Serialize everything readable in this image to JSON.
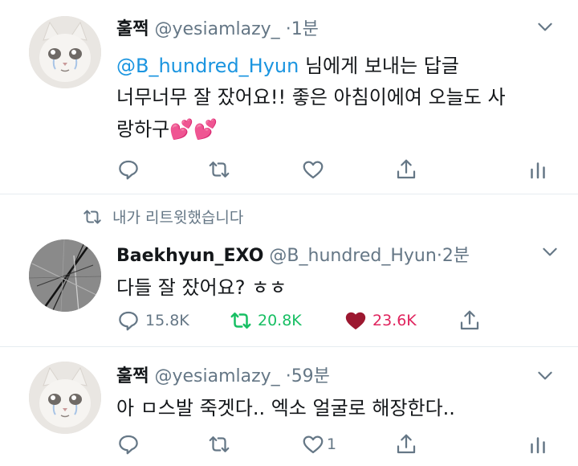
{
  "tweet1": {
    "name": "훌쩍",
    "handle": "@yesiamlazy_",
    "dot": "·",
    "time": "1분",
    "reply_to_mention": "@B_hundred_Hyun",
    "reply_to_suffix": " 님에게 보내는 답글",
    "line1": "너무너무 잘 잤어요!! 좋은 아침이에여 오늘도 사",
    "line2": "랑하구",
    "emoji": "💕💕",
    "reply_count": "",
    "retweet_count": "",
    "like_count": ""
  },
  "retweet_notice": "내가 리트윗했습니다",
  "tweet2": {
    "name": "Baekhyun_EXO",
    "handle": "@B_hundred_Hyun",
    "dot": "·",
    "time": "2분",
    "text": "다들 잘 잤어요? ㅎㅎ",
    "reply_count": "15.8K",
    "retweet_count": "20.8K",
    "like_count": "23.6K"
  },
  "tweet3": {
    "name": "훌쩍",
    "handle": "@yesiamlazy_",
    "dot": "·",
    "time": "59분",
    "text": "아 ㅁ스발 죽겟다.. 엑소 얼굴로 해장한다..",
    "reply_count": "",
    "retweet_count": "",
    "like_count": "1"
  },
  "colors": {
    "text": "#14171a",
    "secondary": "#657786",
    "mention": "#1b95e0",
    "retweet_active": "#17bf63",
    "like_active": "#e0245e",
    "divider": "#e6ecf0"
  },
  "icons": [
    "reply-icon",
    "retweet-icon",
    "like-icon",
    "share-icon",
    "analytics-icon",
    "chevron-down-icon"
  ]
}
